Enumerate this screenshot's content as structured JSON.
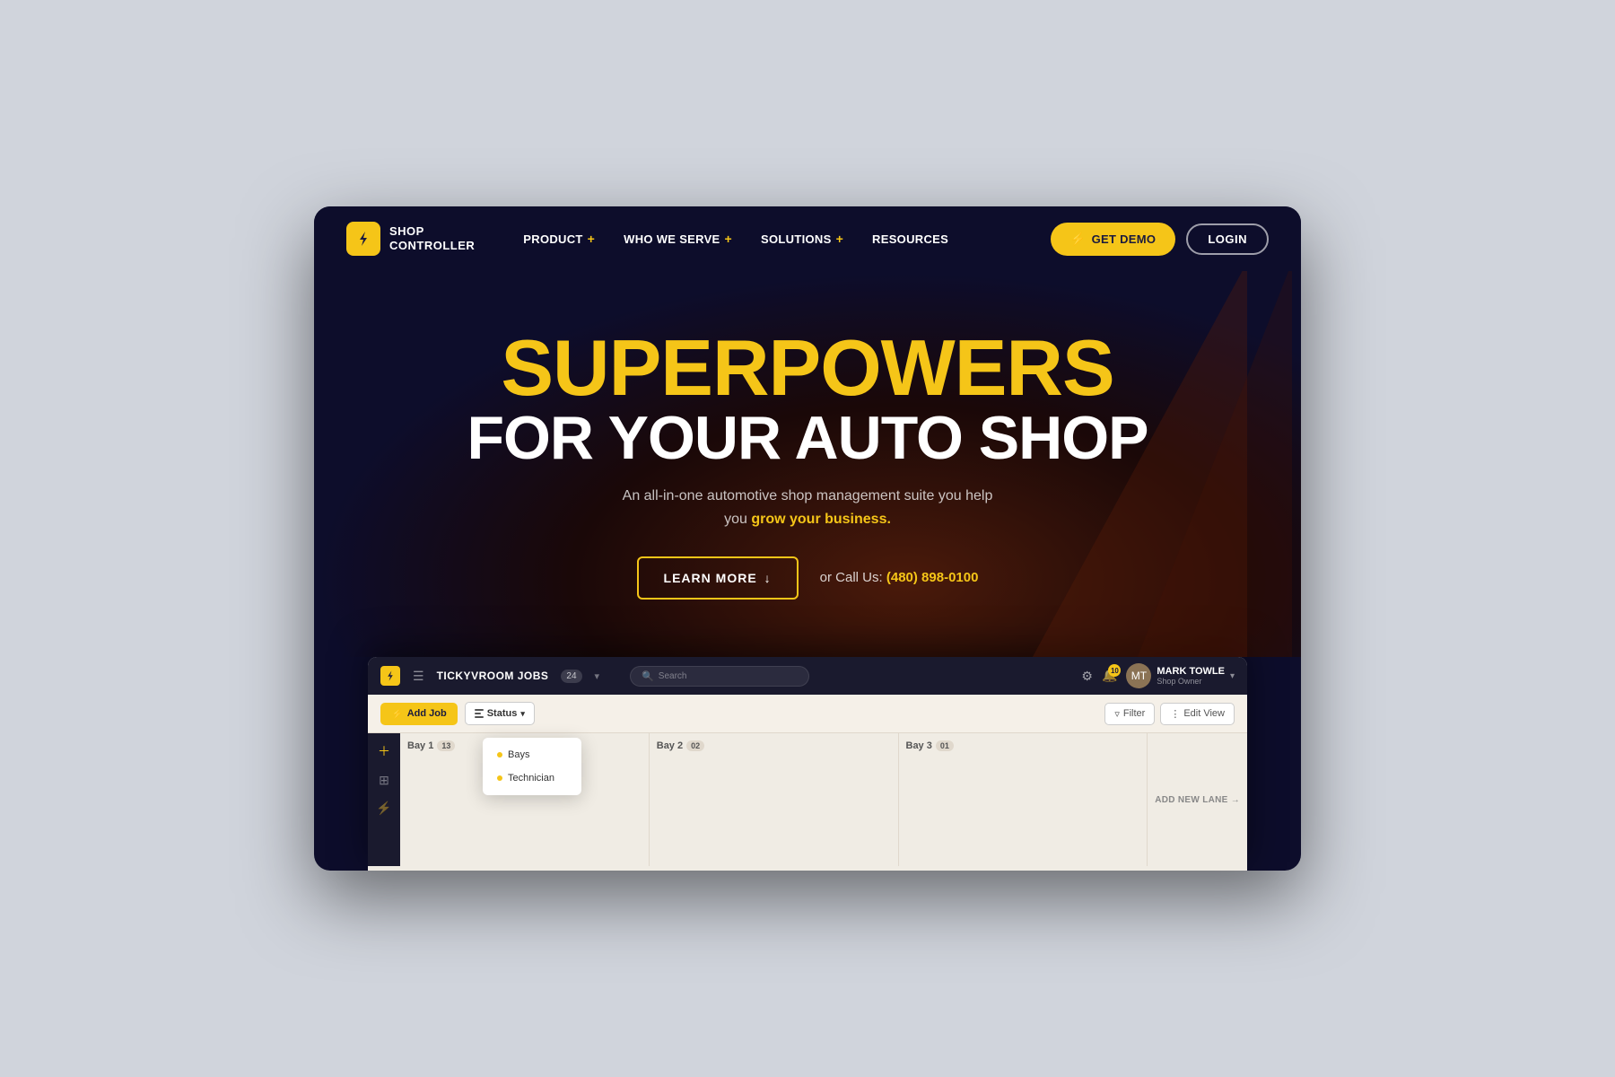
{
  "page": {
    "background_color": "#d0d4dc"
  },
  "navbar": {
    "logo_text": "SHOP\nCONTROLLER",
    "logo_symbol": "⚡",
    "nav_items": [
      {
        "label": "PRODUCT",
        "has_plus": true
      },
      {
        "label": "WHO WE SERVE",
        "has_plus": true
      },
      {
        "label": "SOLUTIONS",
        "has_plus": true
      },
      {
        "label": "RESOURCES",
        "has_plus": false
      }
    ],
    "btn_demo_label": "GET DEMO",
    "btn_login_label": "LOGIN"
  },
  "hero": {
    "title_line1": "SUPERPOWERS",
    "title_line2": "FOR YOUR AUTO SHOP",
    "subtitle": "An all-in-one automotive shop management suite you help you ",
    "subtitle_bold": "grow your business.",
    "btn_learn_label": "LEARN MORE",
    "call_prefix": "or Call Us:",
    "phone": "(480) 898-0100"
  },
  "app_preview": {
    "logo_symbol": "⚡",
    "menu_icon": "☰",
    "shop_name": "TICKYVROOM JOBS",
    "job_count": "24",
    "search_placeholder": "Search",
    "gear_icon": "⚙",
    "notif_count": "10",
    "user_name": "MARK TOWLE",
    "user_role": "Shop Owner",
    "btn_add_job": "Add Job",
    "btn_status": "Status",
    "dropdown_items": [
      "Bays",
      "Technician"
    ],
    "btn_filter": "Filter",
    "btn_edit_view": "Edit View",
    "lanes": [
      {
        "label": "Bay 1",
        "count": "13"
      },
      {
        "label": "Bay 2",
        "count": "02"
      },
      {
        "label": "Bay 3",
        "count": "01"
      }
    ],
    "add_lane_label": "ADD NEW LANE →",
    "sidebar_icons": [
      "＋",
      "⊞",
      "⚡"
    ]
  }
}
